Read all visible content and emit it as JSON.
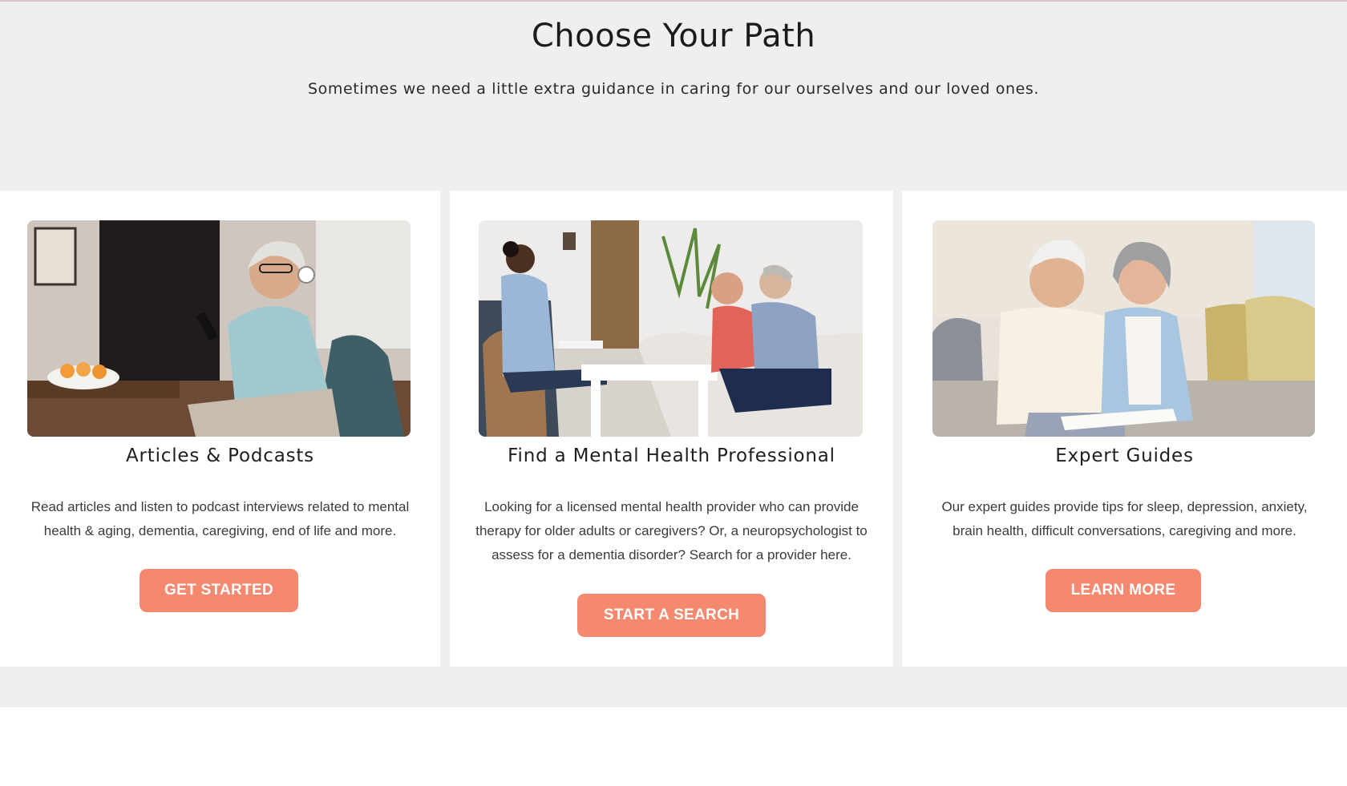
{
  "header": {
    "title": "Choose Your Path",
    "subtitle": "Sometimes we need a little extra guidance in caring for our ourselves and our loved ones."
  },
  "cards": [
    {
      "title": "Articles & Podcasts",
      "description": "Read articles and listen to podcast interviews related to mental health & aging, dementia, caregiving, end of life and more.",
      "button_label": "GET STARTED",
      "image": "woman-with-headphones-photo"
    },
    {
      "title": "Find a Mental Health Professional",
      "description": "Looking for a licensed mental health provider who can provide therapy for older adults or caregivers? Or, a neuropsychologist to assess for a dementia disorder? Search for a provider here.",
      "button_label": "START A SEARCH",
      "image": "therapy-session-photo"
    },
    {
      "title": "Expert Guides",
      "description": "Our expert guides provide tips for sleep, depression, anxiety, brain health, difficult conversations, caregiving and more.",
      "button_label": "LEARN MORE",
      "image": "senior-couple-photo"
    }
  ],
  "colors": {
    "accent": "#f4896f",
    "section_background": "#f0efef",
    "card_background": "#ffffff"
  }
}
